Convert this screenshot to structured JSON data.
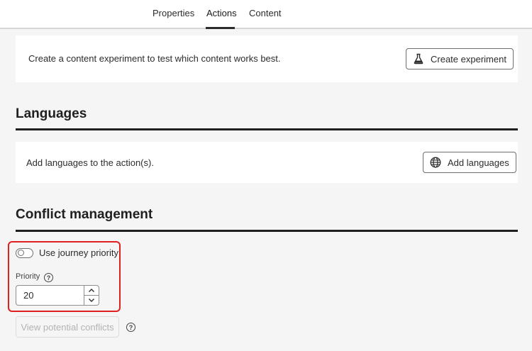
{
  "tabs": [
    {
      "label": "Properties",
      "active": false
    },
    {
      "label": "Actions",
      "active": true
    },
    {
      "label": "Content",
      "active": false
    }
  ],
  "experiment": {
    "description": "Create a content experiment to test which content works best.",
    "button_label": "Create experiment",
    "icon": "flask-icon"
  },
  "languages": {
    "title": "Languages",
    "description": "Add languages to the action(s).",
    "button_label": "Add languages",
    "icon": "globe-icon"
  },
  "conflict": {
    "title": "Conflict management",
    "toggle_label": "Use journey priority",
    "toggle_on": false,
    "priority_label": "Priority",
    "priority_value": "20",
    "view_conflicts_label": "View potential conflicts",
    "highlight_color": "#e01f1f"
  }
}
